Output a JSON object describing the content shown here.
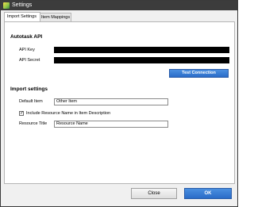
{
  "window": {
    "title": "Settings"
  },
  "tabs": [
    {
      "label": "Import Settings",
      "active": true
    },
    {
      "label": "Item Mappings",
      "active": false
    }
  ],
  "autotask": {
    "section_title": "Autotask API",
    "api_key_label": "API Key",
    "api_secret_label": "API Secret",
    "test_button": "Test Connection"
  },
  "import": {
    "section_title": "Import settings",
    "default_item_label": "Default Item",
    "default_item_value": "Other Item",
    "include_resource_label": "Include Resource Name in Item Description",
    "include_resource_checked": true,
    "resource_title_label": "Resource Title",
    "resource_title_value": "Resource Name"
  },
  "footer": {
    "close_label": "Close",
    "ok_label": "OK"
  },
  "colors": {
    "titlebar": "#3c3c3c",
    "accent_button": "#2a6cc8"
  }
}
